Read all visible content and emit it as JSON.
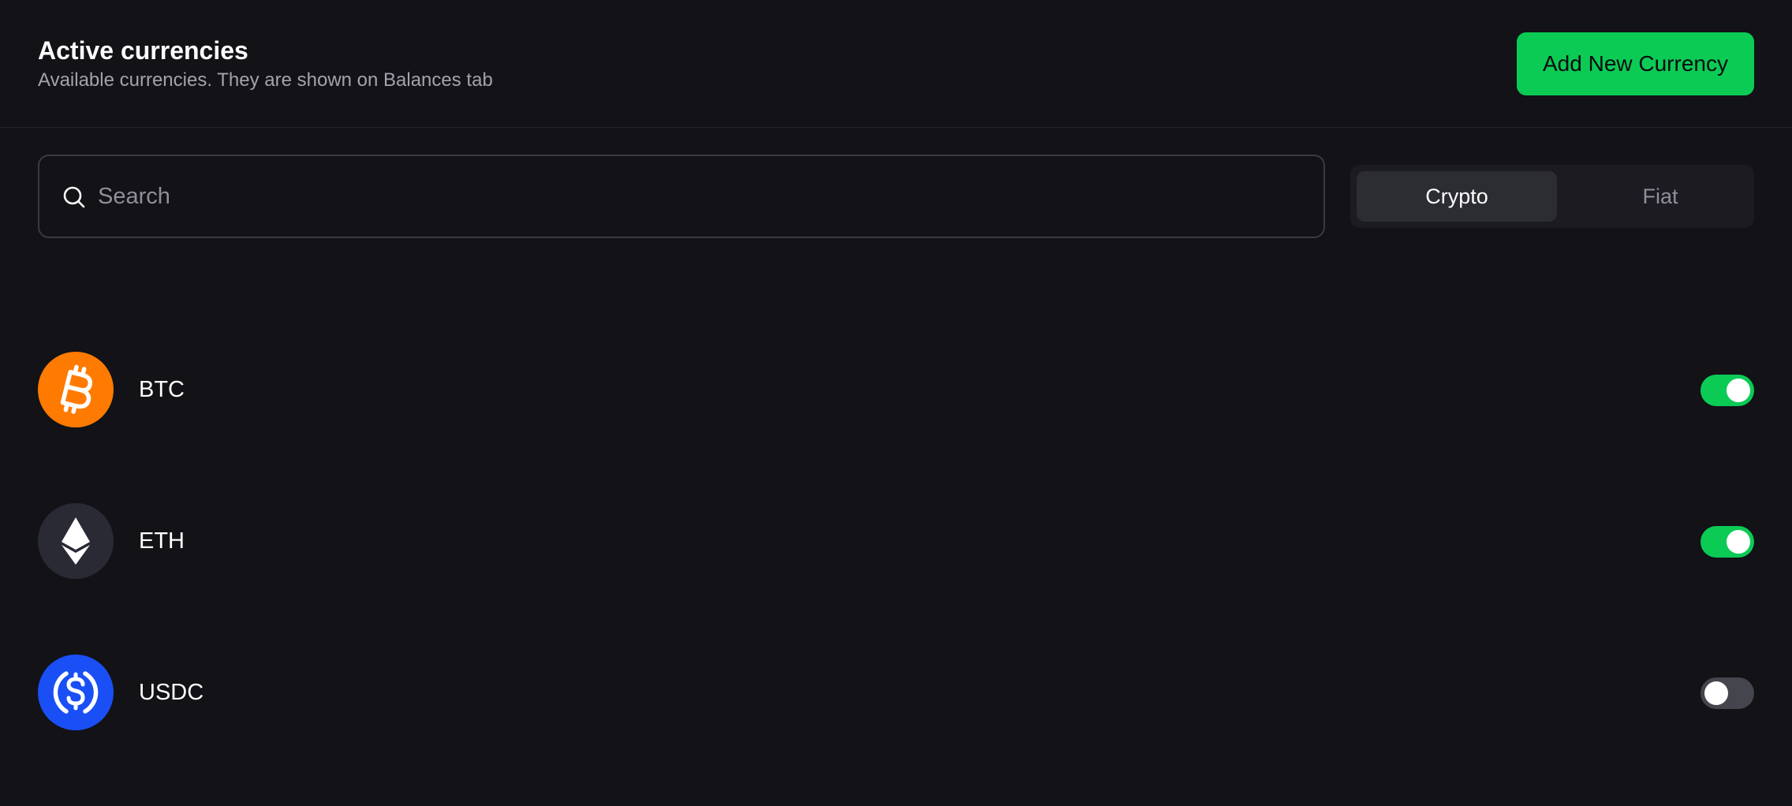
{
  "header": {
    "title": "Active currencies",
    "subtitle": "Available currencies. They are shown on Balances tab",
    "add_button_label": "Add New Currency"
  },
  "search": {
    "placeholder": "Search",
    "value": "",
    "icon": "search-icon"
  },
  "tabs": [
    {
      "label": "Crypto",
      "selected": true
    },
    {
      "label": "Fiat",
      "selected": false
    }
  ],
  "currencies": [
    {
      "code": "BTC",
      "icon": "bitcoin-icon",
      "color": "#ff7a00",
      "enabled": true
    },
    {
      "code": "ETH",
      "icon": "ethereum-icon",
      "color": "#2a2a35",
      "enabled": true
    },
    {
      "code": "USDC",
      "icon": "usdc-icon",
      "color": "#1a4ff5",
      "enabled": false
    }
  ],
  "colors": {
    "background": "#121217",
    "accent": "#0bcb55",
    "toggle_off": "#45454d"
  }
}
